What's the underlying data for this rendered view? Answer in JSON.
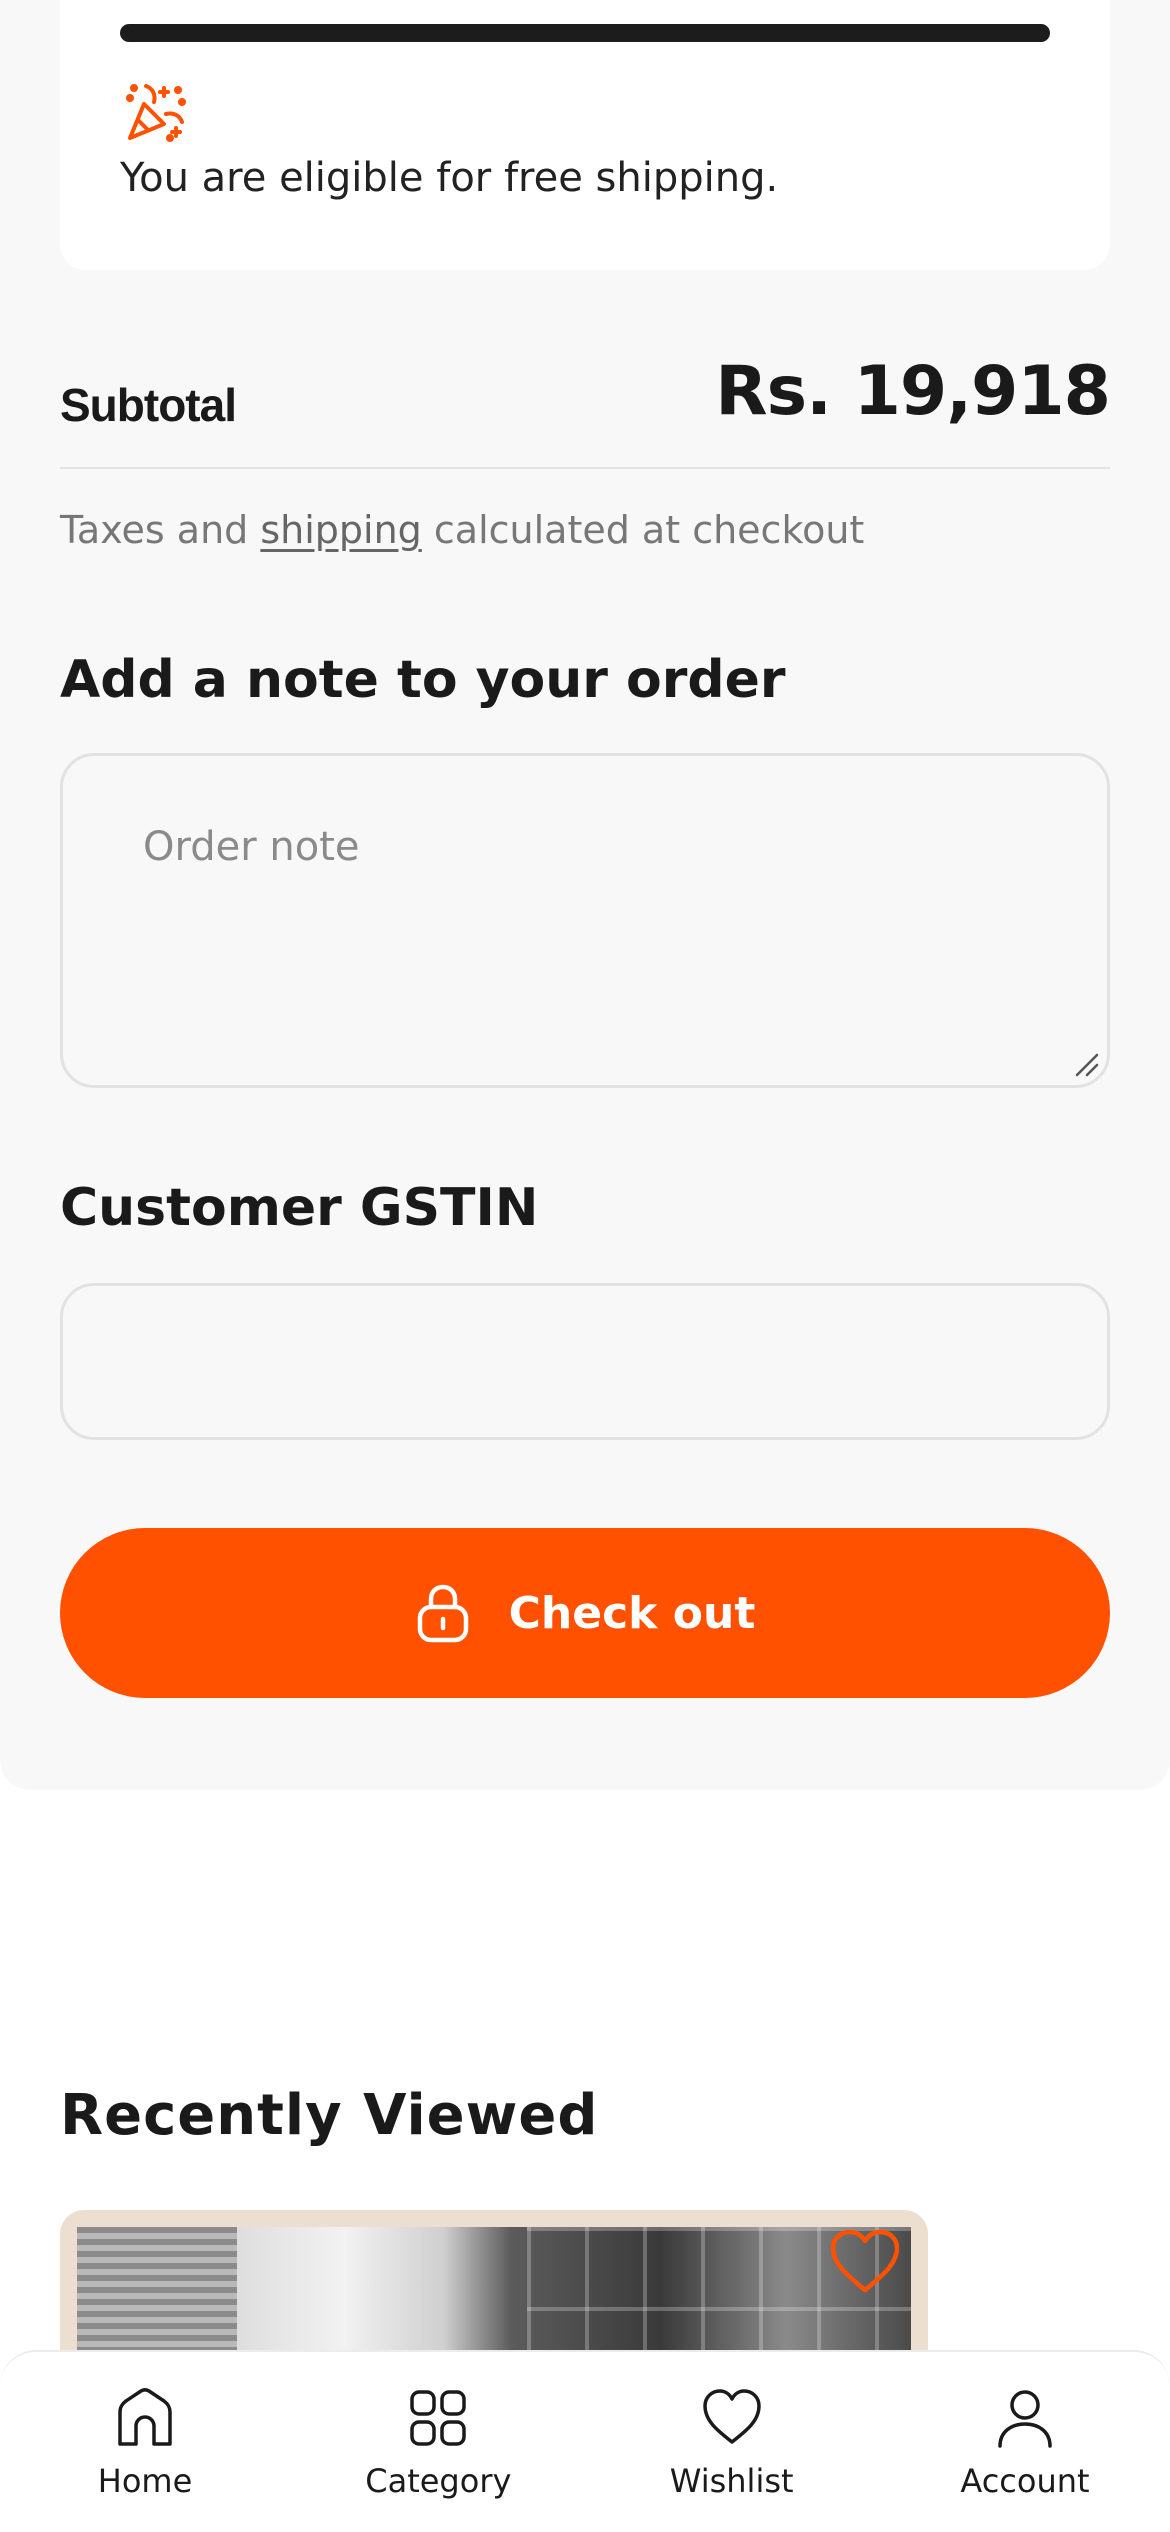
{
  "shipping": {
    "progress": 1.0,
    "message": "You are eligible for free shipping.",
    "icon": "party-popper-icon"
  },
  "subtotal": {
    "label": "Subtotal",
    "value": "Rs. 19,918"
  },
  "tax_note": {
    "before": "Taxes and ",
    "link": "shipping",
    "after": " calculated at checkout"
  },
  "order_note": {
    "heading": "Add a note to your order",
    "placeholder": "Order note",
    "value": ""
  },
  "gstin": {
    "heading": "Customer GSTIN",
    "value": ""
  },
  "checkout": {
    "label": "Check out",
    "icon": "lock-icon"
  },
  "recently_viewed": {
    "heading": "Recently Viewed"
  },
  "bottom_nav": {
    "items": [
      {
        "label": "Home",
        "icon": "home-icon"
      },
      {
        "label": "Category",
        "icon": "category-grid-icon"
      },
      {
        "label": "Wishlist",
        "icon": "heart-icon"
      },
      {
        "label": "Account",
        "icon": "user-icon"
      }
    ]
  },
  "colors": {
    "accent": "#ff5100",
    "background": "#f8f8f8",
    "text": "#1a1a1a"
  }
}
